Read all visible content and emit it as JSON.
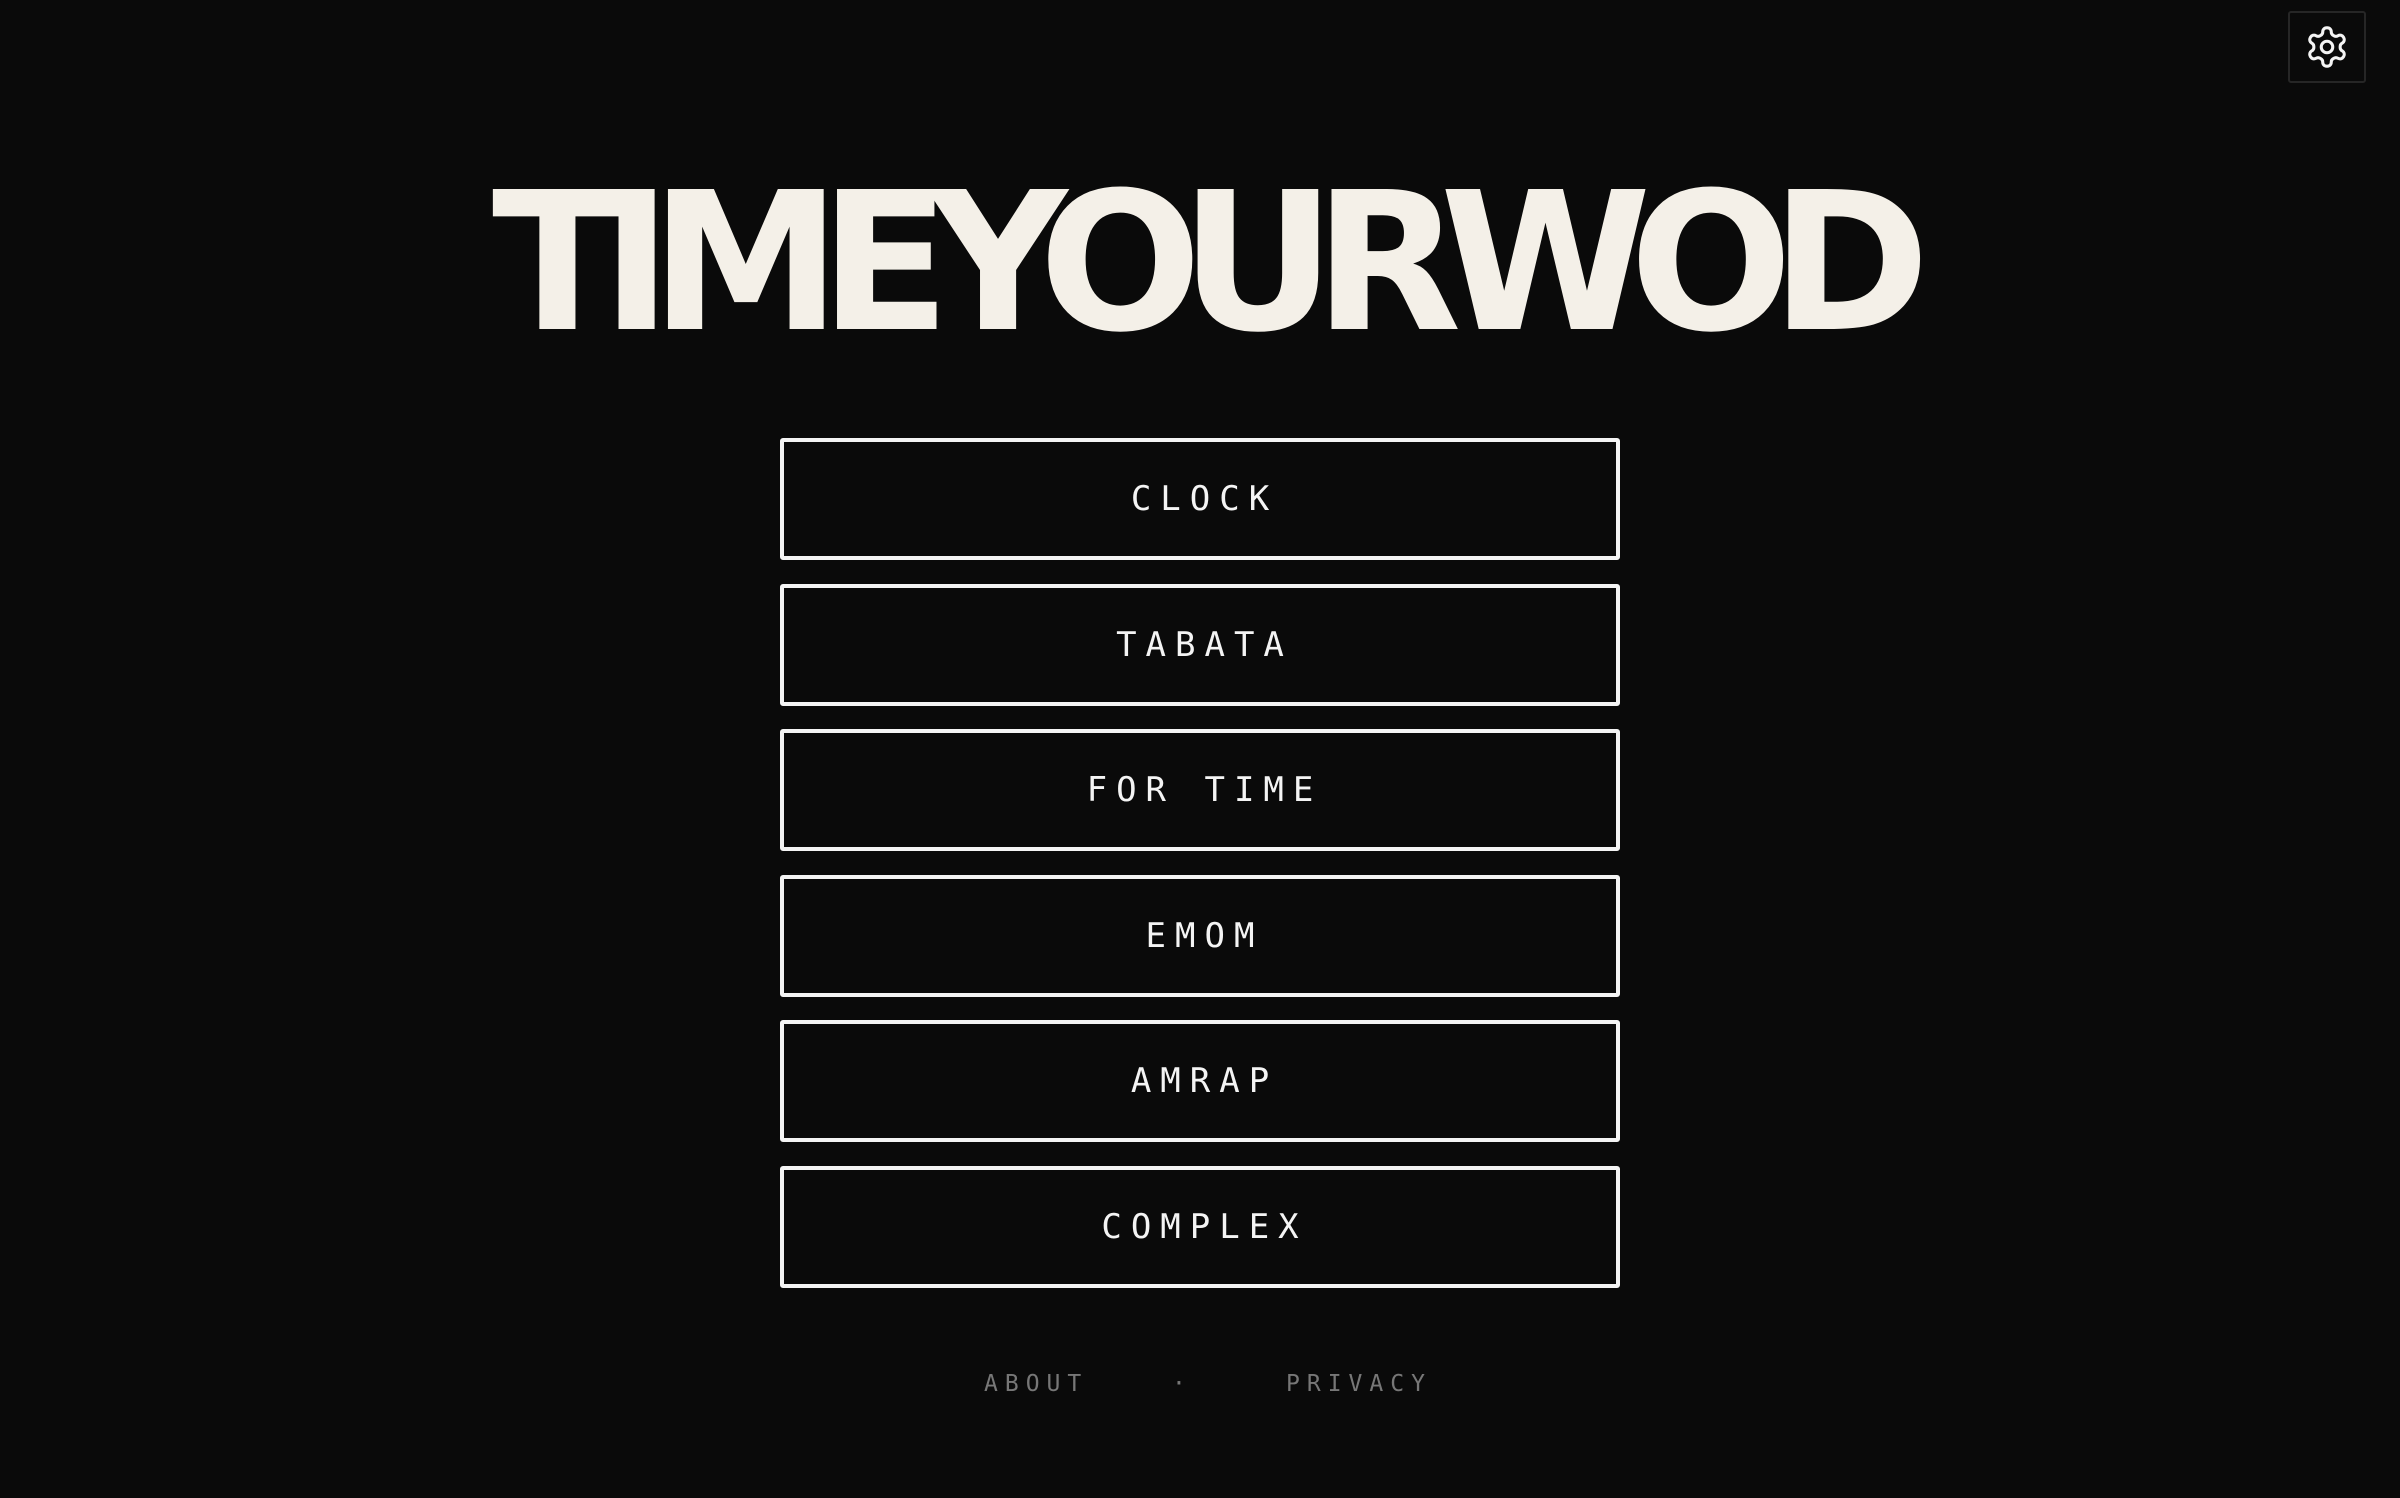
{
  "app": {
    "title": "TIMEYOURWOD"
  },
  "settings": {
    "icon": "gear-icon",
    "color": "#f4f4f4"
  },
  "menu": {
    "items": [
      {
        "label": "CLOCK"
      },
      {
        "label": "TABATA"
      },
      {
        "label": "FOR TIME"
      },
      {
        "label": "EMOM"
      },
      {
        "label": "AMRAP"
      },
      {
        "label": "COMPLEX"
      }
    ]
  },
  "footer": {
    "about": "ABOUT",
    "separator": "·",
    "privacy": "PRIVACY"
  },
  "colors": {
    "background": "#0a0a0a",
    "title": "#f4f0e8",
    "button_border": "#f4f4f4",
    "footer_text": "#777777"
  }
}
